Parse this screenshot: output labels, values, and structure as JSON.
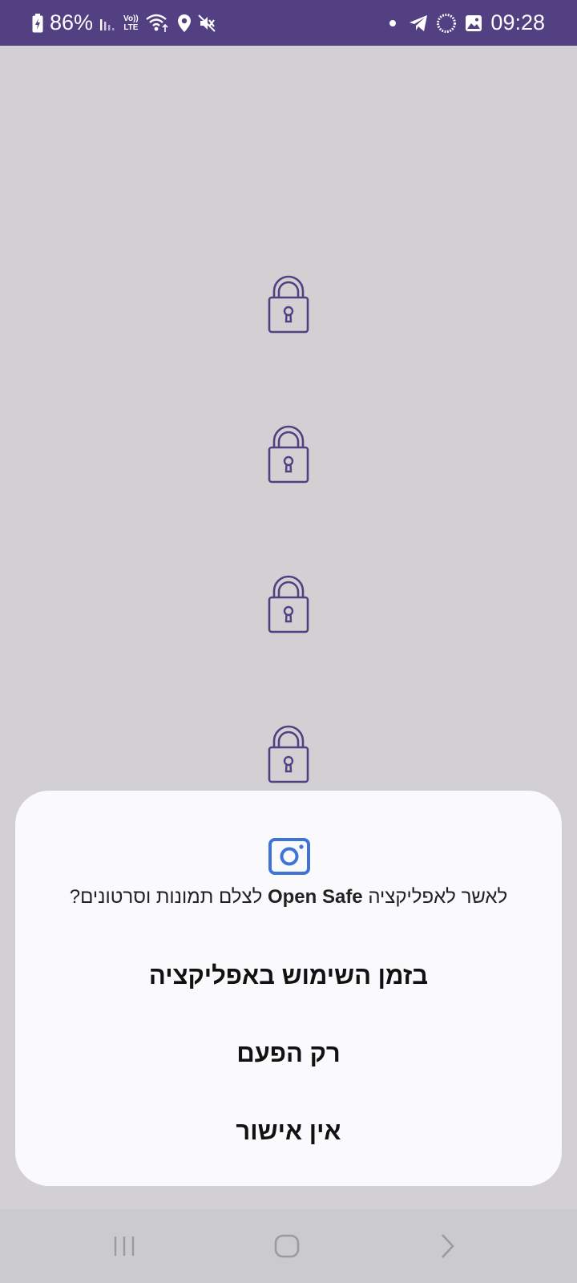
{
  "status_bar": {
    "battery": "86%",
    "lte_top": "Vo))",
    "lte_bottom": "LTE",
    "time": "09:28"
  },
  "dialog": {
    "prompt_prefix": "לאשר לאפליקציה",
    "app_name": "Open Safe",
    "prompt_suffix": "לצלם תמונות וסרטונים?",
    "options": [
      "בזמן השימוש באפליקציה",
      "רק הפעם",
      "אין אישור"
    ]
  },
  "colors": {
    "status_bar_bg": "#524082",
    "background": "#d2d0d3",
    "lock_icon": "#524082",
    "camera_icon": "#3d74d6",
    "sheet_bg": "#fafafd"
  },
  "icons": {
    "locks": [
      "lock-icon",
      "lock-icon",
      "lock-icon",
      "lock-icon"
    ],
    "dialog": "camera-icon",
    "nav": [
      "recent-apps-icon",
      "home-icon",
      "back-icon"
    ]
  }
}
